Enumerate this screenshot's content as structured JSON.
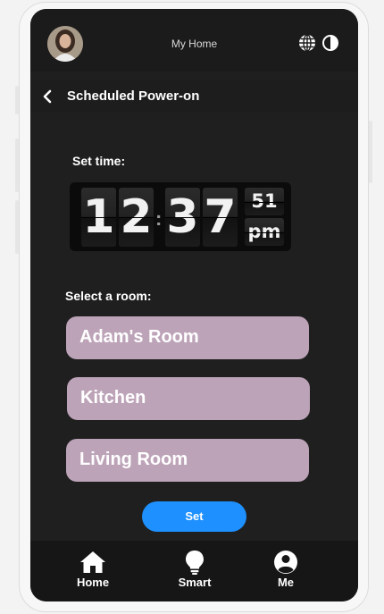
{
  "app": {
    "title": "My Home"
  },
  "header": {
    "title": "Scheduled Power-on"
  },
  "time": {
    "label": "Set time:",
    "hour_tens": "1",
    "hour_ones": "2",
    "minute_tens": "3",
    "minute_ones": "7",
    "seconds": "51",
    "period": "pm"
  },
  "rooms": {
    "label": "Select a room:",
    "items": [
      {
        "label": "Adam's Room"
      },
      {
        "label": "Kitchen"
      },
      {
        "label": "Living Room"
      }
    ]
  },
  "actions": {
    "set_label": "Set"
  },
  "nav": {
    "items": [
      {
        "label": "Home",
        "icon": "home-icon"
      },
      {
        "label": "Smart",
        "icon": "bulb-icon"
      },
      {
        "label": "Me",
        "icon": "user-icon"
      }
    ]
  },
  "colors": {
    "accent": "#1e90ff",
    "room_card": "#bda3b8",
    "background": "#1f1f1f"
  }
}
